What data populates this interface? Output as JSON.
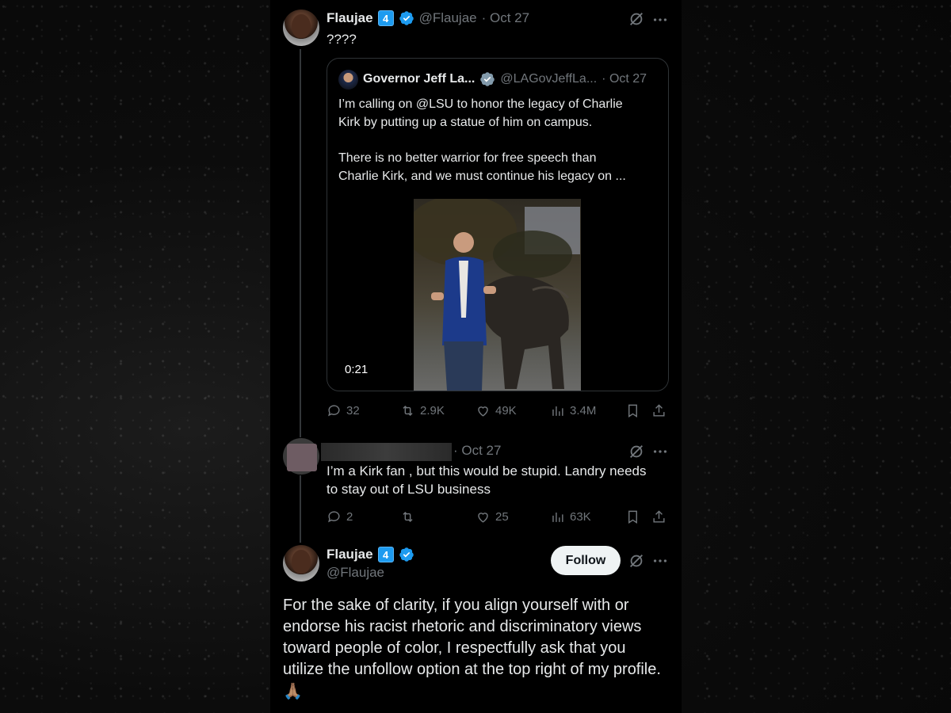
{
  "tweet1": {
    "name": "Flaujae",
    "badge": "4",
    "handle": "@Flaujae",
    "date": "· Oct 27",
    "text": "????"
  },
  "quote": {
    "name": "Governor Jeff La...",
    "handle": "@LAGovJeffLa...",
    "date": "· Oct 27",
    "text_line1": "I’m calling on @LSU to honor the legacy of Charlie",
    "text_line2": "Kirk by putting up a statue of him on campus.",
    "text_line3": "There is no better warrior for free speech than",
    "text_line4": "Charlie Kirk, and we must continue his legacy on ...",
    "video_duration": "0:21"
  },
  "tweet1_actions": {
    "replies": "32",
    "reposts": "2.9K",
    "likes": "49K",
    "views": "3.4M"
  },
  "tweet2": {
    "date": "· Oct 27",
    "text_line1": "I’m a Kirk fan , but this would be stupid. Landry needs",
    "text_line2": "to stay out of LSU business"
  },
  "tweet2_actions": {
    "replies": "2",
    "likes": "25",
    "views": "63K"
  },
  "tweet3": {
    "name": "Flaujae",
    "badge": "4",
    "handle": "@Flaujae",
    "follow_label": "Follow",
    "line1": "For the sake of clarity, if you align yourself with or",
    "line2": "endorse his racist rhetoric and discriminatory views",
    "line3": "toward people of color, I respectfully ask that you",
    "line4": "utilize the unfollow option at the top right of my profile.",
    "emoji": "🙏🏽"
  },
  "colors": {
    "accent": "#1d9bf0",
    "muted": "#71767b",
    "text": "#e7e9ea",
    "background": "#000000"
  },
  "icons": [
    "verified-icon",
    "grok-icon",
    "more-icon",
    "reply-icon",
    "repost-icon",
    "like-icon",
    "views-icon",
    "bookmark-icon",
    "share-icon"
  ]
}
